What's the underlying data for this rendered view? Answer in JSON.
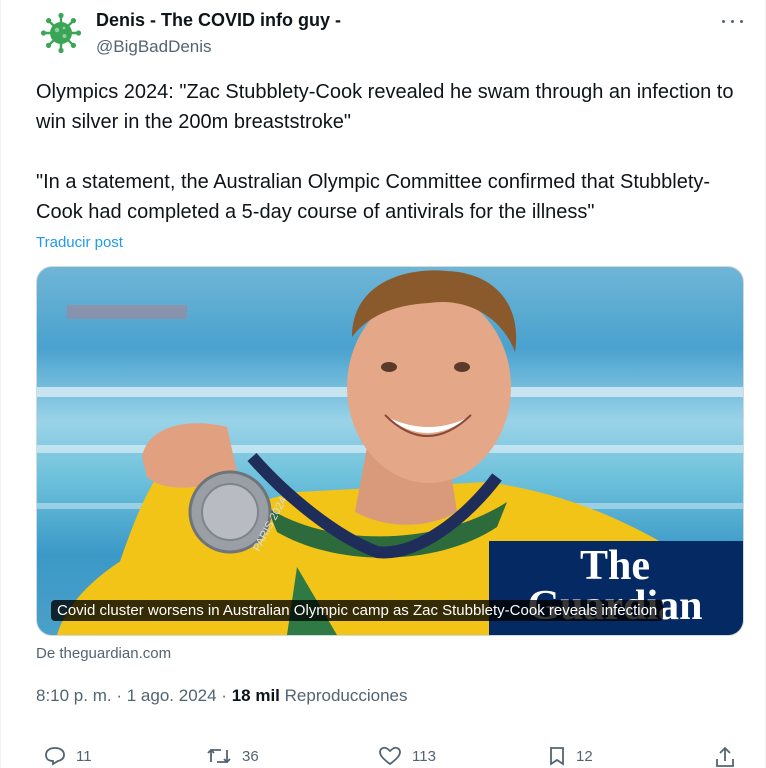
{
  "author": {
    "name": "Denis - The COVID info guy -",
    "handle": "@BigBadDenis"
  },
  "post": {
    "paragraph1": "Olympics 2024: \"Zac Stubblety-Cook revealed he swam through an infection to win silver in the 200m breaststroke\"",
    "paragraph2": "\"In a statement, the Australian Olympic Committee confirmed that Stubblety-Cook had completed a 5-day course of antivirals for the illness\"",
    "translate_label": "Traducir post"
  },
  "card": {
    "caption": "Covid cluster worsens in Australian Olympic camp as Zac Stubblety-Cook reveals infection",
    "logo_line1": "The",
    "logo_line2": "Guardian",
    "medal_text": "PARIS 2024",
    "source": "De theguardian.com"
  },
  "meta": {
    "time": "8:10 p. m.",
    "sep1": "·",
    "date": "1 ago. 2024",
    "sep2": "·",
    "views_count": "18 mil",
    "views_label": "Reproducciones"
  },
  "actions": {
    "replies": "11",
    "reposts": "36",
    "likes": "113",
    "bookmarks": "12"
  },
  "colors": {
    "accent": "#1d9bf0",
    "muted": "#536471",
    "avatar_green": "#3aa655",
    "guardian_blue": "#052962"
  }
}
